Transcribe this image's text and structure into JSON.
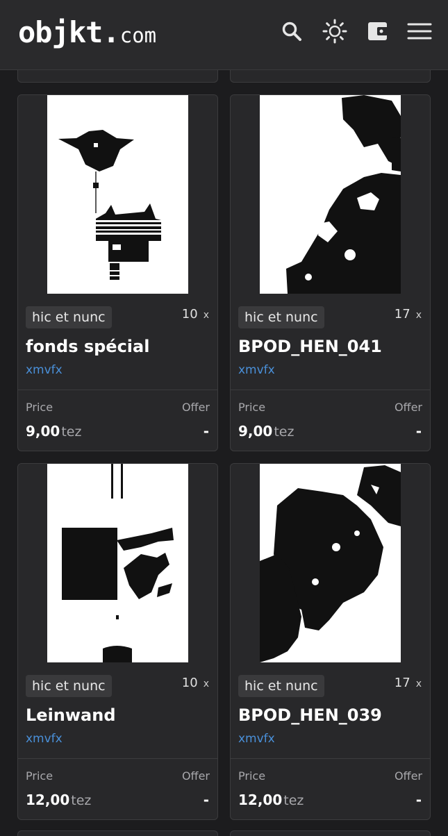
{
  "header": {
    "logo_main": "objkt",
    "logo_dot": ".",
    "logo_suffix": "com",
    "icons": [
      "search-icon",
      "theme-toggle-icon",
      "wallet-icon",
      "menu-icon"
    ]
  },
  "labels": {
    "price": "Price",
    "offer": "Offer",
    "currency": "tez",
    "edition_suffix": "x"
  },
  "cards": [
    {
      "platform": "hic et nunc",
      "editions": "10",
      "title": "fonds spécial",
      "artist": "xmvfx",
      "price": "9,00",
      "offer": "-"
    },
    {
      "platform": "hic et nunc",
      "editions": "17",
      "title": "BPOD_HEN_041",
      "artist": "xmvfx",
      "price": "9,00",
      "offer": "-"
    },
    {
      "platform": "hic et nunc",
      "editions": "10",
      "title": "Leinwand",
      "artist": "xmvfx",
      "price": "12,00",
      "offer": "-"
    },
    {
      "platform": "hic et nunc",
      "editions": "17",
      "title": "BPOD_HEN_039",
      "artist": "xmvfx",
      "price": "12,00",
      "offer": "-"
    }
  ],
  "colors": {
    "background": "#1c1c1e",
    "card": "#28282a",
    "artist_link": "#4a90d9"
  }
}
